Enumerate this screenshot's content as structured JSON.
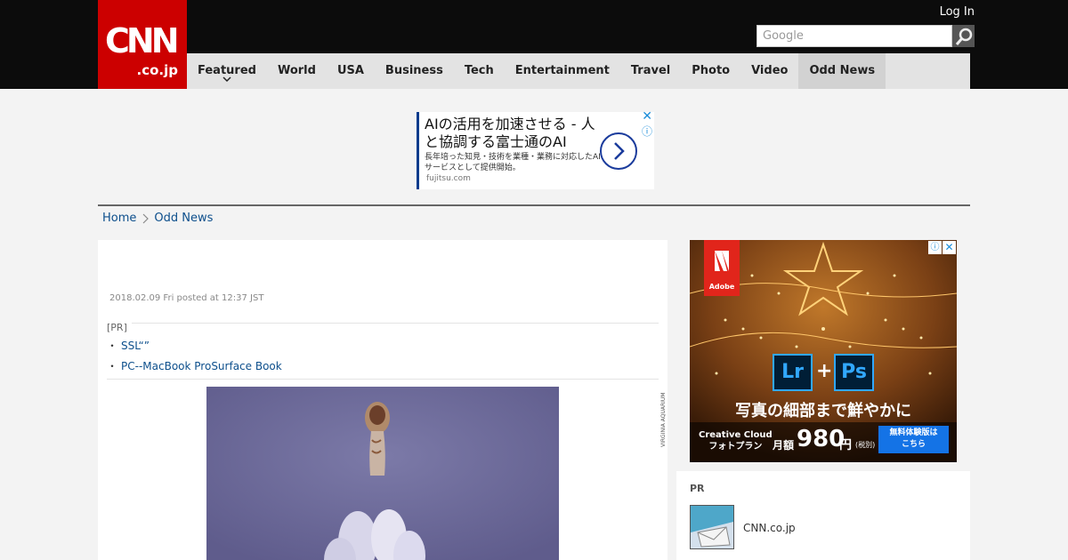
{
  "header": {
    "logo_main": "CNN",
    "logo_sub": ".co.jp",
    "login_label": "Log In",
    "search_placeholder": "Google"
  },
  "nav": {
    "items": [
      {
        "label": "Featured"
      },
      {
        "label": "World"
      },
      {
        "label": "USA"
      },
      {
        "label": "Business"
      },
      {
        "label": "Tech"
      },
      {
        "label": "Entertainment"
      },
      {
        "label": "Travel"
      },
      {
        "label": "Photo"
      },
      {
        "label": "Video"
      },
      {
        "label": "Odd News"
      }
    ],
    "active": "Odd News"
  },
  "top_ad": {
    "title": "AIの活用を加速させる - 人と協調する富士通のAI",
    "body": "長年培った知見・技術を業種・業務に対応したAIサービスとして提供開始。",
    "domain": "fujitsu.com",
    "close": "✕",
    "info": "ⓘ"
  },
  "breadcrumb": {
    "home": "Home",
    "section": "Odd News"
  },
  "article": {
    "posted": "2018.02.09 Fri posted at 12:37 JST",
    "pr_label": "[PR]",
    "pr_links": [
      {
        "bullet": "・",
        "text": "SSL“”"
      },
      {
        "bullet": "・",
        "text": "PC--MacBook ProSurface Book"
      }
    ],
    "photo_credit": "VIRGINIA AQUARIUM"
  },
  "side_ad": {
    "brand": "Adobe",
    "app1": "Lr",
    "plus": "+",
    "app2": "Ps",
    "tagline": "写真の細部まで鮮やかに",
    "product_line1": "Creative Cloud",
    "product_line2": "フォトプラン",
    "price_label": "月額",
    "price": "980",
    "currency": "円",
    "tax_note": "(税別)",
    "cta_line1": "無料体験版は",
    "cta_line2": "こちら",
    "info": "ⓘ",
    "close": "✕"
  },
  "pr_box": {
    "label": "PR",
    "item_name": "CNN.co.jp"
  },
  "colors": {
    "brand_red": "#cc0000",
    "link_blue": "#0d4f8c",
    "nav_bg": "#e3e3e3",
    "topbar_bg": "#0c0c0c"
  }
}
